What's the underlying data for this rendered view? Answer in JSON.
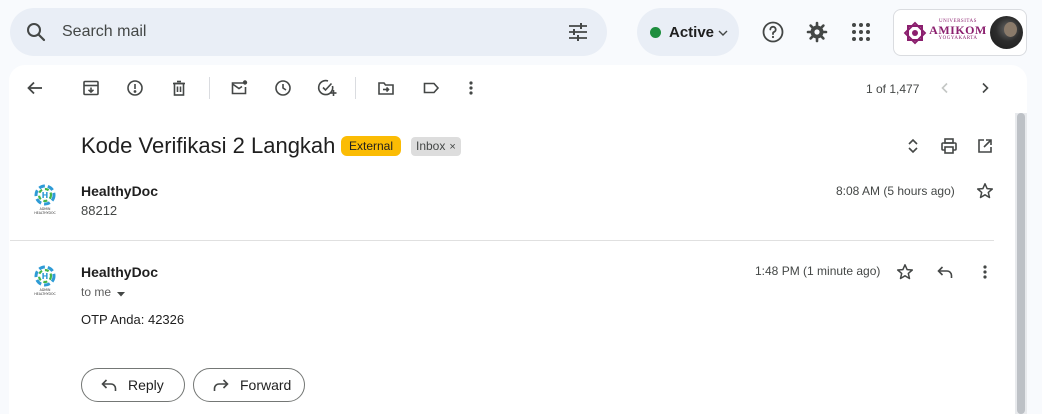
{
  "search": {
    "placeholder": "Search mail"
  },
  "status": {
    "label": "Active",
    "color": "#1e8e3e"
  },
  "topbar_icons": [
    "help-icon",
    "settings-icon",
    "apps-icon"
  ],
  "account": {
    "logo_line1": "UNIVERSITAS",
    "logo_line2": "AMIKOM",
    "logo_line3": "YOGYAKARTA"
  },
  "toolbar": {
    "icons": [
      "back-icon",
      "archive-icon",
      "report-spam-icon",
      "delete-icon",
      "mark-unread-icon",
      "snooze-icon",
      "add-task-icon",
      "move-to-icon",
      "label-icon",
      "more-icon"
    ],
    "pager_text": "1 of 1,477"
  },
  "thread": {
    "subject": "Kode Verifikasi 2 Langkah",
    "labels": {
      "external": "External",
      "inbox": "Inbox",
      "remove": "×"
    },
    "colors": {
      "external": "#fbbc04",
      "inbox": "#dddddd"
    }
  },
  "messages": [
    {
      "sender": "HealthyDoc",
      "snippet": "88212",
      "time": "8:08 AM (5 hours ago)",
      "logo_text": "ADMIN HEALTHYDOC"
    },
    {
      "sender": "HealthyDoc",
      "recipient": "to me",
      "time": "1:48 PM (1 minute ago)",
      "body": "OTP Anda: 42326",
      "logo_text": "ADMIN HEALTHYDOC"
    }
  ],
  "actions": {
    "reply": "Reply",
    "forward": "Forward"
  }
}
